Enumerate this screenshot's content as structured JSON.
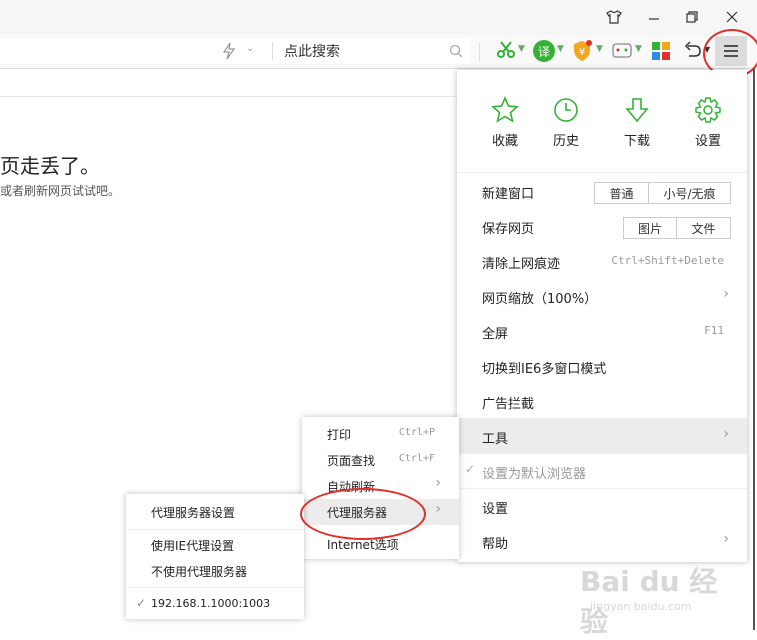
{
  "titlebar": {
    "icons": [
      "shirt-icon",
      "minimize-icon",
      "restore-icon",
      "close-icon"
    ]
  },
  "toolbar": {
    "search_placeholder": "点此搜索",
    "menu_icon": "hamburger-icon"
  },
  "page": {
    "error_title": "页走丢了。",
    "error_subtitle": "或者刷新网页试试吧。"
  },
  "main_menu": {
    "quick_actions": [
      {
        "label": "收藏",
        "icon": "star-icon"
      },
      {
        "label": "历史",
        "icon": "clock-icon"
      },
      {
        "label": "下载",
        "icon": "download-arrow-icon"
      },
      {
        "label": "设置",
        "icon": "gear-icon"
      }
    ],
    "new_window": {
      "label": "新建窗口",
      "options": [
        "普通",
        "小号/无痕"
      ]
    },
    "save_page": {
      "label": "保存网页",
      "options": [
        "图片",
        "文件"
      ]
    },
    "clear_traces": {
      "label": "清除上网痕迹",
      "shortcut": "Ctrl+Shift+Delete"
    },
    "zoom": {
      "label": "网页缩放（100%）"
    },
    "fullscreen": {
      "label": "全屏",
      "shortcut": "F11"
    },
    "ie6_mode": {
      "label": "切换到IE6多窗口模式"
    },
    "ad_block": {
      "label": "广告拦截"
    },
    "tools": {
      "label": "工具"
    },
    "set_default": {
      "label": "设置为默认浏览器"
    },
    "settings": {
      "label": "设置"
    },
    "help": {
      "label": "帮助"
    }
  },
  "tools_submenu": {
    "print": {
      "label": "打印",
      "shortcut": "Ctrl+P"
    },
    "find": {
      "label": "页面查找",
      "shortcut": "Ctrl+F"
    },
    "auto_refresh": {
      "label": "自动刷新"
    },
    "proxy": {
      "label": "代理服务器"
    },
    "internet_options": {
      "label": "Internet选项"
    }
  },
  "proxy_submenu": {
    "proxy_settings": "代理服务器设置",
    "use_ie_proxy": "使用IE代理设置",
    "no_proxy": "不使用代理服务器",
    "proxy_address": "192.168.1.1000:1003"
  },
  "watermark": {
    "brand": "Bai du 经验",
    "url": "jingyan.baidu.com"
  },
  "colors": {
    "annotation_red": "#e0302a",
    "accent_green": "#34b233",
    "hover_grey": "#ececec"
  }
}
